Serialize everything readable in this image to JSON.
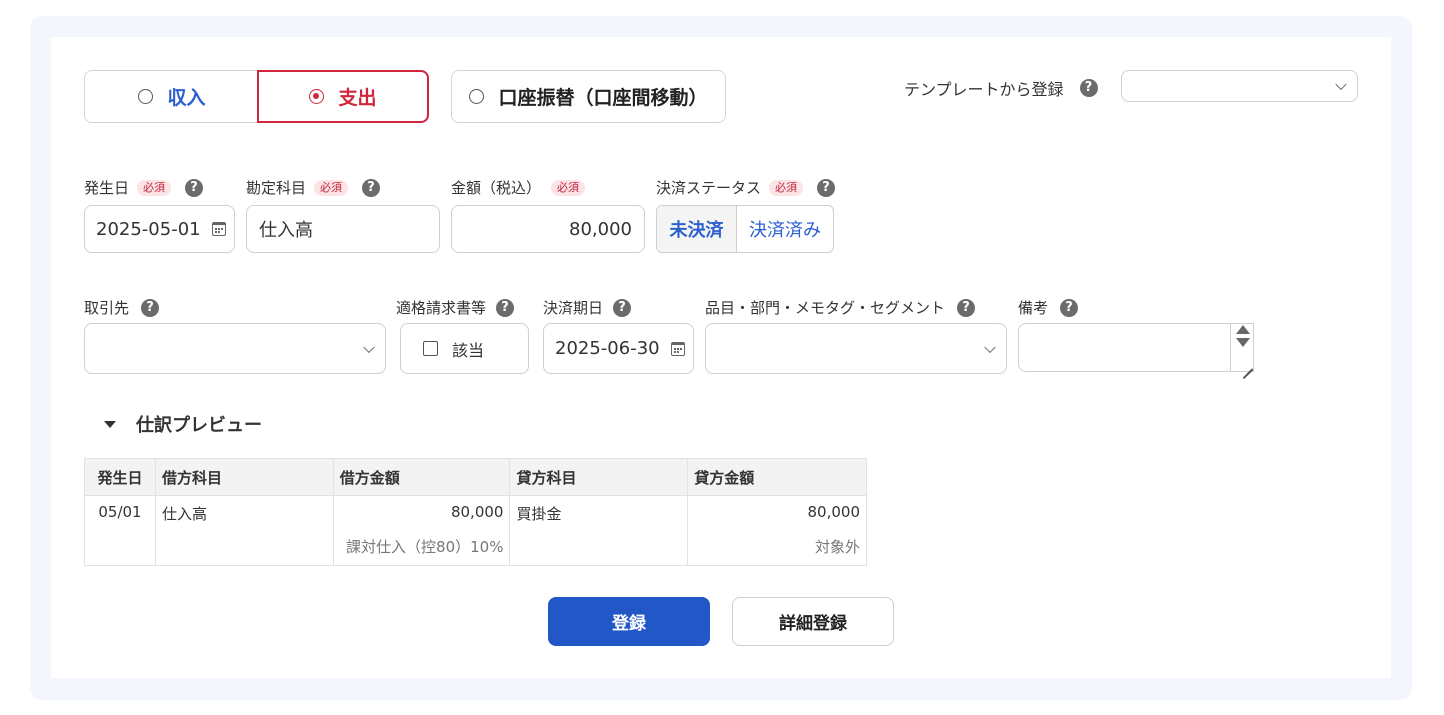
{
  "type_selector": {
    "income_label": "収入",
    "expense_label": "支出",
    "transfer_label": "口座振替（口座間移動）"
  },
  "template": {
    "label": "テンプレートから登録",
    "value": ""
  },
  "required_badge": "必須",
  "help_glyph": "?",
  "fields": {
    "date_label": "発生日",
    "date_value": "2025-05-01",
    "account_label": "勘定科目",
    "account_value": "仕入高",
    "amount_label": "金額（税込）",
    "amount_value": "80,000",
    "status_label": "決済ステータス",
    "status_unpaid": "未決済",
    "status_paid": "決済済み",
    "partner_label": "取引先",
    "partner_value": "",
    "invoice_label": "適格請求書等",
    "invoice_checkbox_label": "該当",
    "due_date_label": "決済期日",
    "due_date_value": "2025-06-30",
    "tags_label": "品目・部門・メモタグ・セグメント",
    "tags_value": "",
    "memo_label": "備考",
    "memo_value": ""
  },
  "preview": {
    "toggle_label": "仕訳プレビュー",
    "headers": [
      "発生日",
      "借方科目",
      "借方金額",
      "貸方科目",
      "貸方金額"
    ],
    "row": {
      "date": "05/01",
      "debit_account": "仕入高",
      "debit_amount": "80,000",
      "credit_account": "買掛金",
      "credit_amount": "80,000",
      "debit_tax": "課対仕入（控80）10%",
      "credit_tax": "対象外"
    }
  },
  "buttons": {
    "register": "登録",
    "detail_register": "詳細登録"
  },
  "colors": {
    "accent_blue": "#2257c8",
    "expense_red": "#d0263b",
    "panel_bg": "#f3f6fd"
  }
}
